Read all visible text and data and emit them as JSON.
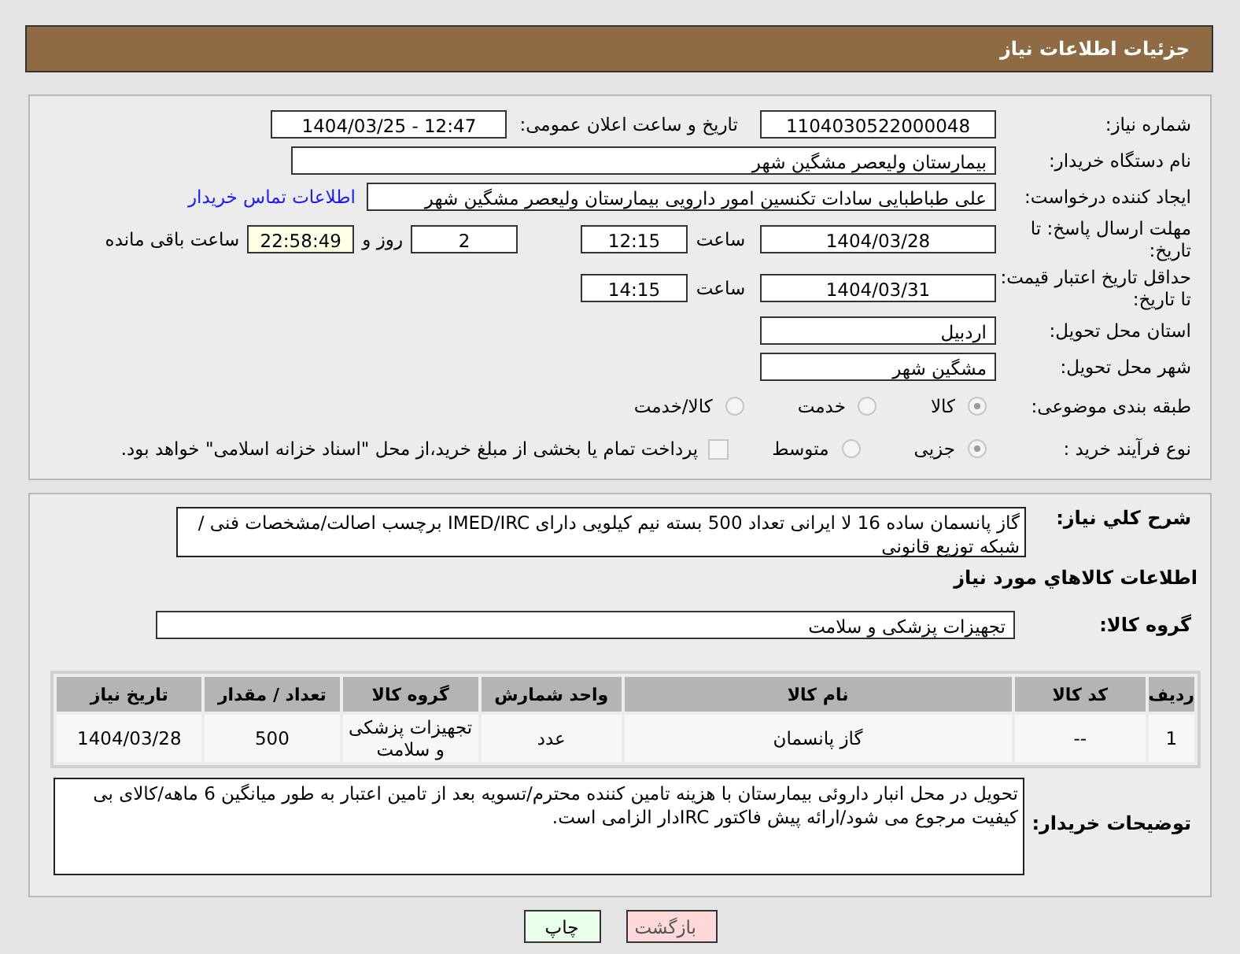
{
  "header": {
    "title": "جزئیات اطلاعات نیاز"
  },
  "need_number": {
    "label": "شماره نیاز:",
    "value": "1104030522000048"
  },
  "announce": {
    "label": "تاریخ و ساعت اعلان عمومی:",
    "value": "1404/03/25 - 12:47"
  },
  "buyer": {
    "label": "نام دستگاه خریدار:",
    "value": "بیمارستان ولیعصر مشگین شهر"
  },
  "creator": {
    "label": "ایجاد کننده درخواست:",
    "value": "علی طباطبایی سادات تکنسین امور دارویی بیمارستان ولیعصر مشگین شهر",
    "link": "اطلاعات تماس خریدار"
  },
  "deadline": {
    "label": "مهلت ارسال پاسخ: تا تاریخ:",
    "date": "1404/03/28",
    "time_label": "ساعت",
    "time": "12:15",
    "days": "2",
    "days_label": "روز و",
    "remaining": "22:58:49",
    "remaining_label": "ساعت باقی مانده"
  },
  "validity": {
    "label": "حداقل تاریخ اعتبار قیمت: تا تاریخ:",
    "date": "1404/03/31",
    "time_label": "ساعت",
    "time": "14:15"
  },
  "province": {
    "label": "استان محل تحویل:",
    "value": "اردبیل"
  },
  "city": {
    "label": "شهر محل تحویل:",
    "value": "مشگین شهر"
  },
  "category": {
    "label": "طبقه بندی موضوعی:",
    "options": [
      {
        "label": "کالا",
        "selected": true
      },
      {
        "label": "خدمت",
        "selected": false
      },
      {
        "label": "کالا/خدمت",
        "selected": false
      }
    ]
  },
  "process": {
    "label": "نوع فرآیند خرید :",
    "options": [
      {
        "label": "جزیی",
        "selected": true
      },
      {
        "label": "متوسط",
        "selected": false
      }
    ],
    "treasury": {
      "checked": false,
      "text": "پرداخت تمام یا بخشی از مبلغ خرید،از محل \"اسناد خزانه اسلامی\" خواهد بود."
    }
  },
  "description": {
    "label": "شرح کلي نیاز:",
    "value": "گاز پانسمان ساده 16 لا ایرانی تعداد  500 بسته نیم کیلویی دارای IMED/IRC  برچسب اصالت/مشخصات فنی / شبکه توزیع قانونی"
  },
  "goods_title": "اطلاعات کالاهاي مورد نیاز",
  "goods_group": {
    "label": "گروه کالا:",
    "value": "تجهیزات پزشکی و سلامت"
  },
  "table": {
    "columns": [
      "ردیف",
      "کد کالا",
      "نام کالا",
      "واحد شمارش",
      "گروه کالا",
      "تعداد / مقدار",
      "تاریخ نیاز"
    ],
    "rows": [
      [
        "1",
        "--",
        "گاز پانسمان",
        "عدد",
        "تجهیزات پزشکی و سلامت",
        "500",
        "1404/03/28"
      ]
    ]
  },
  "buyer_notes": {
    "label": "توضیحات خریدار:",
    "value": "تحویل در محل انبار داروئی بیمارستان با هزینه تامین کننده محترم/تسویه بعد از تامین اعتبار به طور میانگین 6 ماهه/کالای بی کیفیت مرجوع می شود/ارائه پیش فاکتور IRCدار الزامی است."
  },
  "buttons": [
    {
      "label": "بازگشت",
      "kind": "back"
    },
    {
      "label": "چاپ",
      "kind": "print"
    }
  ]
}
